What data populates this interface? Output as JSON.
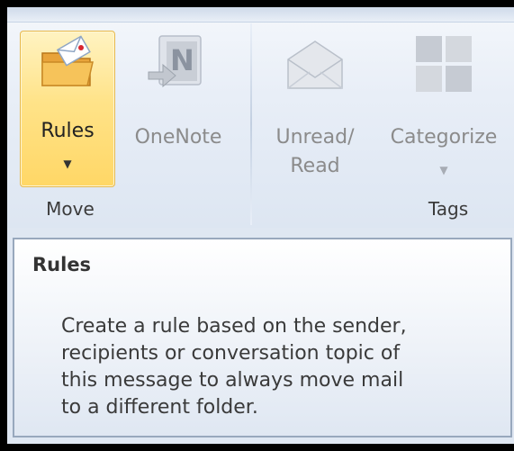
{
  "ribbon": {
    "groups": [
      {
        "label": "Move",
        "buttons": [
          {
            "label": "Rules",
            "icon": "rules-folder-icon",
            "state": "hover"
          },
          {
            "label": "OneNote",
            "icon": "onenote-icon",
            "state": "disabled"
          }
        ]
      },
      {
        "label": "Tags",
        "buttons": [
          {
            "label_line1": "Unread/",
            "label_line2": "Read",
            "icon": "envelope-open-icon",
            "state": "disabled"
          },
          {
            "label": "Categorize",
            "icon": "categorize-grid-icon",
            "state": "disabled"
          }
        ]
      }
    ]
  },
  "tooltip": {
    "title": "Rules",
    "lines": [
      "Create a rule based on the sender,",
      "recipients or conversation topic of",
      "this message to always move mail",
      "to a different folder."
    ]
  },
  "colors": {
    "hover_fill": "#ffd766",
    "ribbon_bg": "#dfe7f2",
    "tooltip_border": "#98a8bd"
  }
}
